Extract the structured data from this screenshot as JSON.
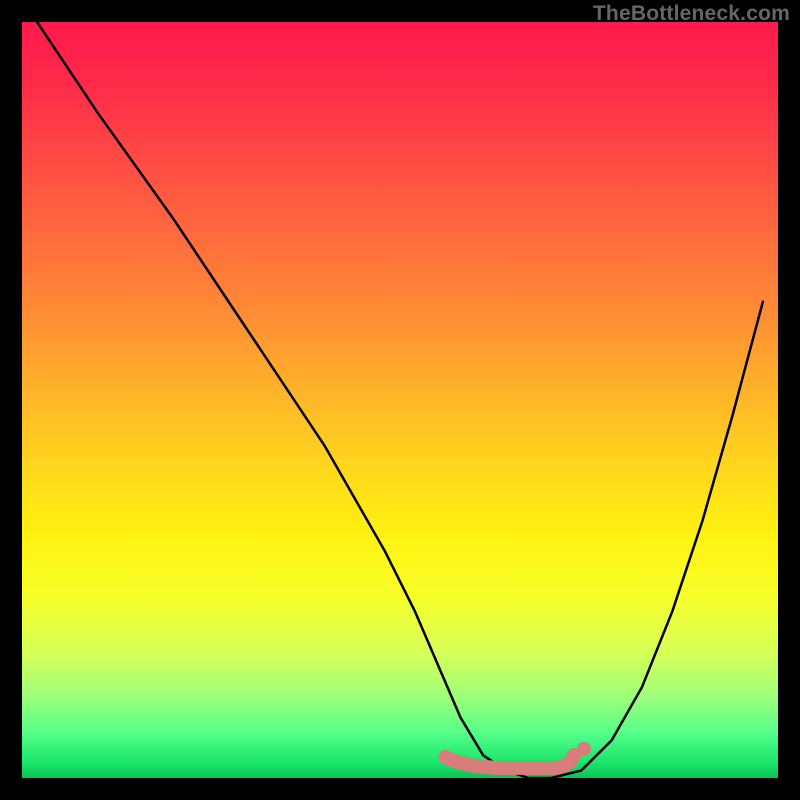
{
  "watermark": "TheBottleneck.com",
  "chart_data": {
    "type": "line",
    "title": "",
    "xlabel": "",
    "ylabel": "",
    "xlim": [
      0,
      100
    ],
    "ylim": [
      0,
      100
    ],
    "series": [
      {
        "name": "bottleneck-curve",
        "x": [
          2,
          10,
          20,
          30,
          40,
          48,
          52,
          55,
          58,
          61,
          64,
          67,
          70,
          74,
          78,
          82,
          86,
          90,
          94,
          98
        ],
        "values": [
          100,
          88,
          74,
          59,
          44,
          30,
          22,
          15,
          8,
          3,
          1,
          0,
          0,
          1,
          5,
          12,
          22,
          34,
          48,
          63
        ]
      }
    ],
    "marker_band": {
      "comment": "pink/coral band near the trough",
      "x_start": 56,
      "x_end": 73,
      "y": 2,
      "color": "#d97c7c"
    },
    "background_gradient": {
      "stops": [
        {
          "pos": 0.0,
          "color": "#ff1a4d"
        },
        {
          "pos": 0.5,
          "color": "#ffd41e"
        },
        {
          "pos": 0.8,
          "color": "#f7ff2a"
        },
        {
          "pos": 1.0,
          "color": "#0fbf57"
        }
      ]
    }
  }
}
